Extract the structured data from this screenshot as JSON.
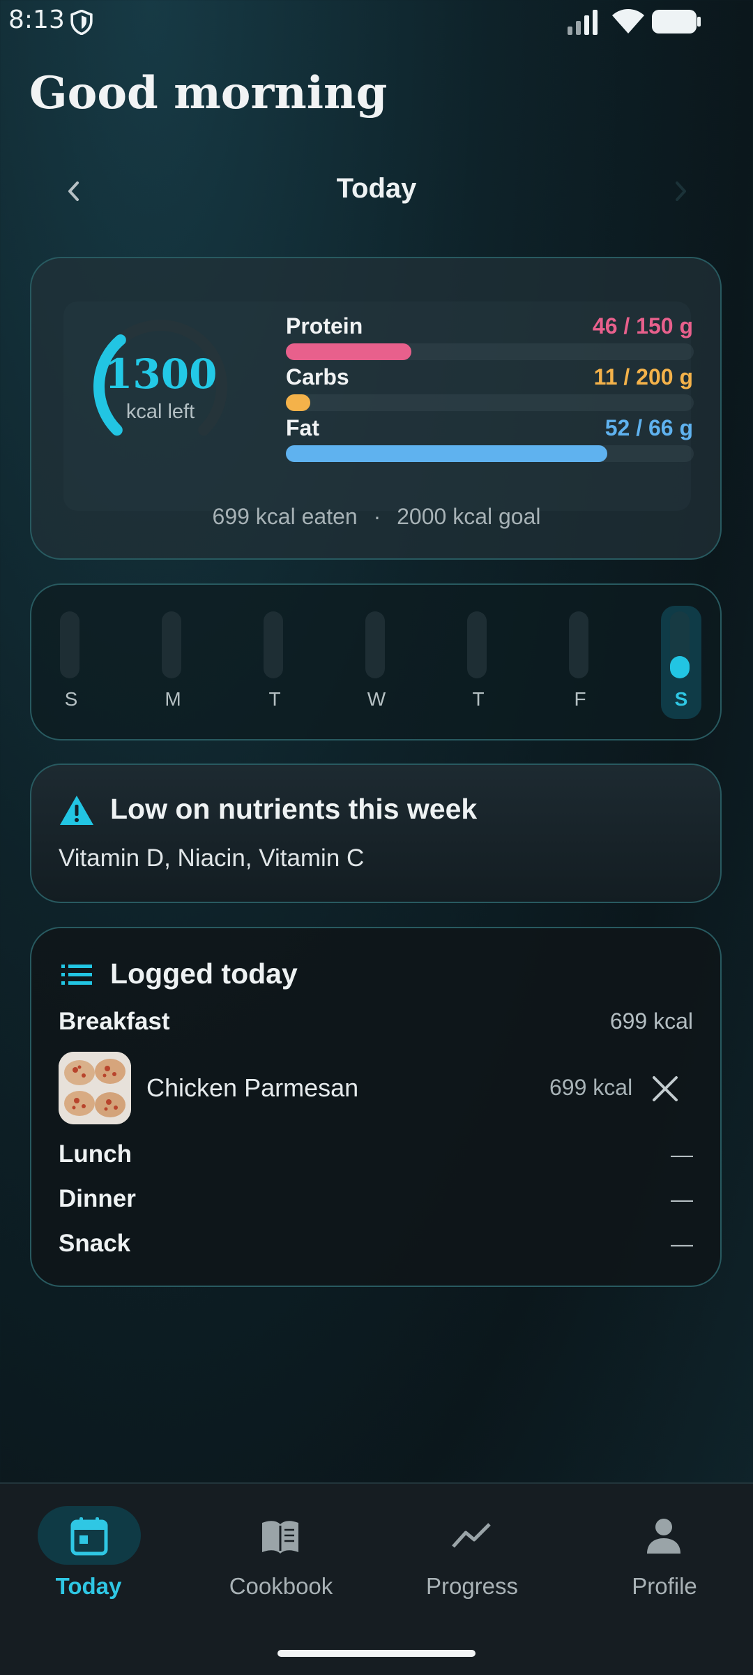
{
  "status_bar": {
    "time": "8:13"
  },
  "greeting": "Good morning",
  "date_nav": {
    "title": "Today"
  },
  "summary": {
    "kcal_left": "1300",
    "kcal_left_label": "kcal left",
    "ring_progress": 0.35,
    "macros": [
      {
        "name": "Protein",
        "value": "46 / 150 g",
        "fraction": 0.307,
        "color": "#e8608c"
      },
      {
        "name": "Carbs",
        "value": "11 / 200 g",
        "fraction": 0.055,
        "color": "#f4b24a"
      },
      {
        "name": "Fat",
        "value": "52 / 66 g",
        "fraction": 0.788,
        "color": "#5fb2ef"
      }
    ],
    "eaten": "699 kcal eaten",
    "separator": "·",
    "goal": "2000 kcal goal"
  },
  "week": {
    "days": [
      "S",
      "M",
      "T",
      "W",
      "T",
      "F",
      "S"
    ],
    "active_index": 6,
    "accent": "#22c5e3"
  },
  "alert": {
    "title": "Low on nutrients this week",
    "body": "Vitamin D, Niacin, Vitamin C",
    "icon": "warning-icon"
  },
  "logged": {
    "title": "Logged today",
    "meals": [
      {
        "name": "Breakfast",
        "value": "699 kcal"
      },
      {
        "name": "Lunch",
        "value": "—"
      },
      {
        "name": "Dinner",
        "value": "—"
      },
      {
        "name": "Snack",
        "value": "—"
      }
    ],
    "items": [
      {
        "name": "Chicken Parmesan",
        "kcal": "699 kcal"
      }
    ]
  },
  "bottom_nav": [
    {
      "label": "Today",
      "icon": "calendar-icon",
      "active": true
    },
    {
      "label": "Cookbook",
      "icon": "book-icon",
      "active": false
    },
    {
      "label": "Progress",
      "icon": "trending-icon",
      "active": false
    },
    {
      "label": "Profile",
      "icon": "person-icon",
      "active": false
    }
  ]
}
